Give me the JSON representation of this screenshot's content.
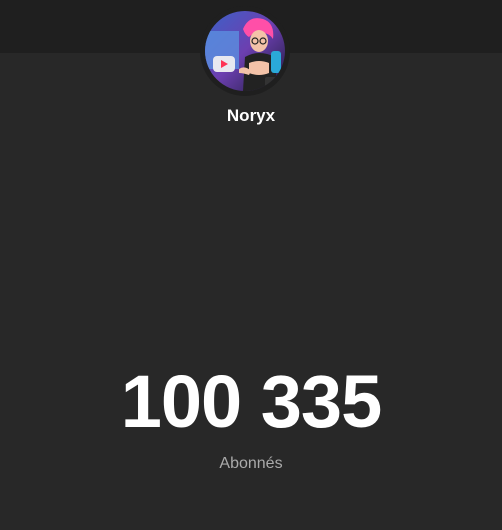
{
  "channel": {
    "name": "Noryx",
    "avatar_icon": "channel-avatar"
  },
  "stats": {
    "subscriber_count": "100 335",
    "subscriber_label": "Abonnés"
  },
  "colors": {
    "background": "#282828",
    "top_bar": "#1f1f1f",
    "count_text": "#ffffff",
    "label_text": "#aaaaaa"
  }
}
